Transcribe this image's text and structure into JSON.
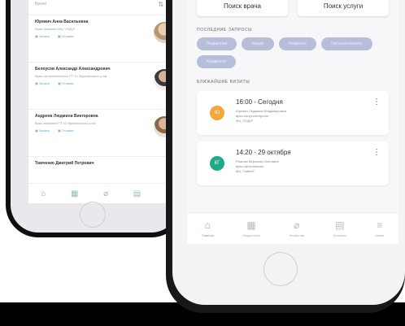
{
  "left_screen": {
    "header_label": "Врачи",
    "doctors": [
      {
        "name": "Юревич Анна Васильевна",
        "subtitle": "Врач-терапевт МЦ \"ЛОДЭ\"",
        "action_primary": "Запись",
        "action_secondary": "Отзывы"
      },
      {
        "name": "Белоусов Александр Александрович",
        "subtitle": "Врач-гастроэнтеролог ГП 10 Фрунзенского р-на",
        "action_primary": "Запись",
        "action_secondary": "Отзывы"
      },
      {
        "name": "Андреев Людмила Викторовна",
        "subtitle": "Врач-терапевт ГП 10 Фрунзенского р-на",
        "action_primary": "Запись",
        "action_secondary": "Отзывы"
      },
      {
        "name": "Тимченко Дмитрий Петрович",
        "subtitle": "",
        "action_primary": "",
        "action_secondary": ""
      }
    ],
    "nav": [
      {
        "icon": "home-icon",
        "glyph": "⌂"
      },
      {
        "icon": "clinic-icon",
        "glyph": "▦"
      },
      {
        "icon": "pill-icon",
        "glyph": "⌀"
      },
      {
        "icon": "clipboard-icon",
        "glyph": "▤"
      },
      {
        "icon": "menu-icon",
        "glyph": "≡"
      }
    ]
  },
  "right_screen": {
    "search_doctor_label": "Поиск врача",
    "search_service_label": "Поиск услуги",
    "recent_requests_title": "ПОСЛЕДНИЕ ЗАПРОСЫ",
    "chips": [
      "Педиатрия",
      "Хирург",
      "Невролог",
      "Гастроэнтеролог",
      "Кардиолог"
    ],
    "nearest_visits_title": "БЛИЖАЙШИЕ ВИЗИТЫ",
    "visits": [
      {
        "badge": "Ю",
        "badge_color": "#f2a93b",
        "time": "16:00 - Сегодня",
        "doctor": "Юревич Людмила Владимировна",
        "specialty": "врач-гастроэнтеролог",
        "clinic": "МЦ \"ЛОДЭ\""
      },
      {
        "badge": "КГ",
        "badge_color": "#1fab8a",
        "time": "14:20 - 29 октября",
        "doctor": "Рыжова Вероника Олеговна",
        "specialty": "врач-офтальмолог",
        "clinic": "МЦ \"Гайвей\""
      }
    ],
    "nav": [
      {
        "icon": "home-icon",
        "label": "Главная",
        "glyph": "⌂",
        "active": true
      },
      {
        "icon": "clinic-icon",
        "label": "Медцентры",
        "glyph": "▦",
        "active": false
      },
      {
        "icon": "pill-icon",
        "label": "Лекарства",
        "glyph": "⌀",
        "active": false
      },
      {
        "icon": "clipboard-icon",
        "label": "Анализы",
        "glyph": "▤",
        "active": false
      },
      {
        "icon": "menu-icon",
        "label": "Меню",
        "glyph": "≡",
        "active": false
      }
    ]
  }
}
